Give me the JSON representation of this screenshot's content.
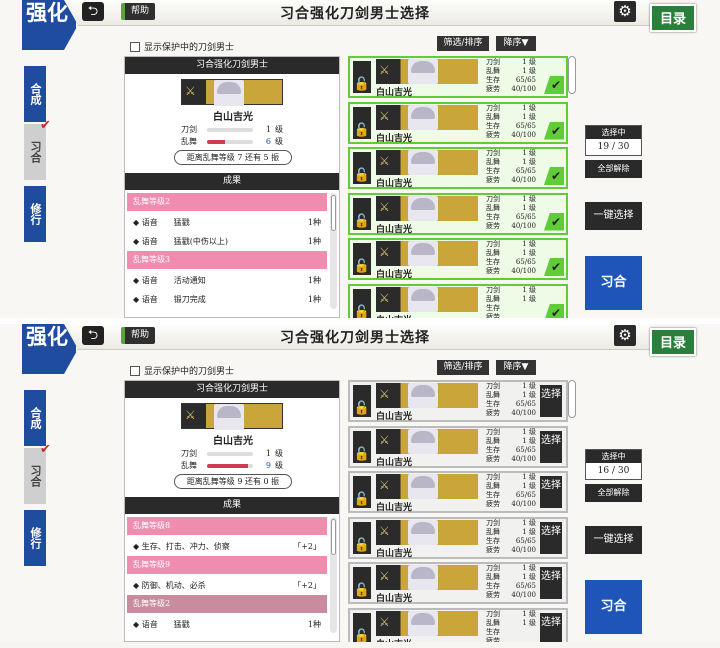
{
  "header": {
    "logo_text": "强化",
    "back_icon": "back-arrow-icon",
    "help_label": "帮助",
    "title": "习合强化刀剑男士选择",
    "settings_icon": "gear-icon",
    "menu_label": "目录"
  },
  "side_tabs": [
    "合成",
    "习合",
    "修行"
  ],
  "active_side_tab": "习合",
  "options": {
    "show_protected_label": "显示保护中的刀剑男士",
    "filter_label": "筛选/排序",
    "sort_label": "降序▼"
  },
  "colors": {
    "accent_blue": "#1f4c9e",
    "selected_green": "#5fcc38",
    "band_pink": "#f08cb0",
    "menu_green": "#2c7e3d"
  },
  "panels": [
    {
      "base": {
        "header": "习合强化刀剑男士",
        "name": "白山吉光",
        "stats": [
          {
            "label": "刀剑",
            "value": "1",
            "unit": "级",
            "fill": 0
          },
          {
            "label": "乱舞",
            "value": "6",
            "unit": "级",
            "fill": 0.4
          }
        ],
        "next_text": "距离乱舞等级 7 还有 5 振"
      },
      "results_header": "成果",
      "results": [
        {
          "kind": "band",
          "text": "乱舞等级2",
          "right": ""
        },
        {
          "kind": "row",
          "text": "◆ 语音　　猛戳",
          "right": "1种"
        },
        {
          "kind": "row",
          "text": "◆ 语音　　猛戳(中伤以上)",
          "right": "1种"
        },
        {
          "kind": "band",
          "text": "乱舞等级3",
          "right": ""
        },
        {
          "kind": "row",
          "text": "◆ 语音　　活动通知",
          "right": "1种"
        },
        {
          "kind": "row",
          "text": "◆ 语音　　锻刀完成",
          "right": "1种"
        }
      ],
      "cards": [
        {
          "name": "白山吉光",
          "sword": "1",
          "ranbu": "1",
          "life": "65/65",
          "fatigue": "40/100",
          "selected": true
        },
        {
          "name": "白山吉光",
          "sword": "1",
          "ranbu": "1",
          "life": "65/65",
          "fatigue": "40/100",
          "selected": true
        },
        {
          "name": "白山吉光",
          "sword": "1",
          "ranbu": "1",
          "life": "65/65",
          "fatigue": "40/100",
          "selected": true
        },
        {
          "name": "白山吉光",
          "sword": "1",
          "ranbu": "1",
          "life": "65/65",
          "fatigue": "40/100",
          "selected": true
        },
        {
          "name": "白山吉光",
          "sword": "1",
          "ranbu": "1",
          "life": "65/65",
          "fatigue": "40/100",
          "selected": true
        },
        {
          "name": "白山吉光",
          "sword": "1",
          "ranbu": "1",
          "life": "",
          "fatigue": "",
          "selected": true
        }
      ],
      "counter_header": "选择中",
      "counter": "19 / 30"
    },
    {
      "base": {
        "header": "习合强化刀剑男士",
        "name": "白山吉光",
        "stats": [
          {
            "label": "刀剑",
            "value": "1",
            "unit": "级",
            "fill": 0
          },
          {
            "label": "乱舞",
            "value": "9",
            "unit": "级",
            "fill": 0.9
          }
        ],
        "next_text": "距离乱舞等级 9 还有 0 振"
      },
      "results_header": "成果",
      "results": [
        {
          "kind": "band",
          "text": "乱舞等级8",
          "right": ""
        },
        {
          "kind": "row",
          "text": "◆ 生存、打击、冲力、侦察",
          "right": "「+2」"
        },
        {
          "kind": "band",
          "text": "乱舞等级9",
          "right": ""
        },
        {
          "kind": "row",
          "text": "◆ 防御、机动、必杀",
          "right": "「+2」"
        },
        {
          "kind": "band dim",
          "text": "乱舞等级2",
          "right": ""
        },
        {
          "kind": "row",
          "text": "◆ 语音　　猛戳",
          "right": "1种"
        }
      ],
      "cards": [
        {
          "name": "白山吉光",
          "sword": "1",
          "ranbu": "1",
          "life": "65/65",
          "fatigue": "40/100",
          "selected": false
        },
        {
          "name": "白山吉光",
          "sword": "1",
          "ranbu": "1",
          "life": "65/65",
          "fatigue": "40/100",
          "selected": false
        },
        {
          "name": "白山吉光",
          "sword": "1",
          "ranbu": "1",
          "life": "65/65",
          "fatigue": "40/100",
          "selected": false
        },
        {
          "name": "白山吉光",
          "sword": "1",
          "ranbu": "1",
          "life": "65/65",
          "fatigue": "40/100",
          "selected": false
        },
        {
          "name": "白山吉光",
          "sword": "1",
          "ranbu": "1",
          "life": "65/65",
          "fatigue": "40/100",
          "selected": false
        },
        {
          "name": "白山吉光",
          "sword": "1",
          "ranbu": "1",
          "life": "",
          "fatigue": "",
          "selected": false
        }
      ],
      "counter_header": "选择中",
      "counter": "16 / 30"
    }
  ],
  "labels": {
    "sword": "刀剑",
    "ranbu": "乱舞",
    "life": "生存",
    "fatigue": "疲劳",
    "level_unit": "级",
    "pick": "选择",
    "clear_all": "全部解除",
    "one_click": "一键选择",
    "go": "习合"
  }
}
